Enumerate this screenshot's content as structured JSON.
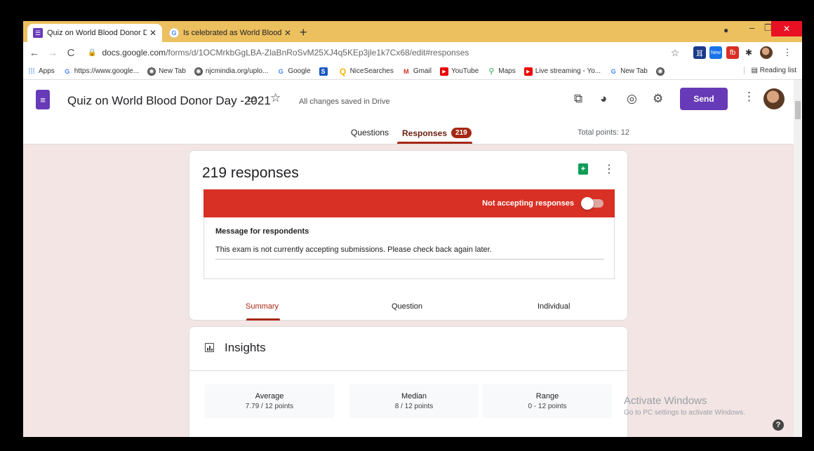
{
  "browser": {
    "tabs": [
      {
        "title": "Quiz on World Blood Donor Day",
        "favicon": "forms-icon"
      },
      {
        "title": "Is celebrated as World Blood Do",
        "favicon": "google-g-icon"
      }
    ],
    "new_tab": "+",
    "url_main": "docs.google.com",
    "url_rest": "/forms/d/1OCMrkbGgLBA-ZlaBnRoSvM25XJ4q5KEp3jle1k7Cx68/edit#responses",
    "bookmarks": [
      {
        "label": "Apps",
        "icon": "apps-grid-icon"
      },
      {
        "label": "https://www.google...",
        "icon": "google-g-icon"
      },
      {
        "label": "New Tab",
        "icon": "globe-icon"
      },
      {
        "label": "njcmindia.org/uplo...",
        "icon": "globe-icon"
      },
      {
        "label": "Google",
        "icon": "google-g-icon"
      },
      {
        "label": "",
        "icon": "s-icon"
      },
      {
        "label": "NiceSearches",
        "icon": "search-icon"
      },
      {
        "label": "Gmail",
        "icon": "gmail-icon"
      },
      {
        "label": "YouTube",
        "icon": "youtube-icon"
      },
      {
        "label": "Maps",
        "icon": "maps-icon"
      },
      {
        "label": "Live streaming - Yo...",
        "icon": "youtube-icon"
      },
      {
        "label": "New Tab",
        "icon": "google-g-icon"
      },
      {
        "label": "",
        "icon": "globe-icon"
      }
    ],
    "reading_list": "Reading list",
    "ext_new_badge": "New"
  },
  "forms_header": {
    "title": "Quiz on World Blood Donor Day -2021",
    "saved_status": "All changes saved in Drive",
    "send_label": "Send",
    "tabs": {
      "questions": "Questions",
      "responses": "Responses",
      "responses_count": "219"
    },
    "total_points": "Total points: 12"
  },
  "responses_card": {
    "heading": "219 responses",
    "banner_label": "Not accepting responses",
    "accepting": false,
    "message_title": "Message for respondents",
    "message_body": "This exam is not currently accepting submissions. Please check back again later.",
    "subtabs": [
      "Summary",
      "Question",
      "Individual"
    ],
    "active_subtab": "Summary"
  },
  "insights": {
    "title": "Insights",
    "stats": [
      {
        "label": "Average",
        "value": "7.79 / 12 points"
      },
      {
        "label": "Median",
        "value": "8 / 12 points"
      },
      {
        "label": "Range",
        "value": "0 - 12 points"
      }
    ]
  },
  "watermark": {
    "title": "Activate Windows",
    "subtitle": "Go to PC settings to activate Windows."
  },
  "colors": {
    "tabstrip": "#ecbf5f",
    "forms_purple": "#673ab7",
    "accent_red": "#a52714",
    "banner_red": "#d93025",
    "background": "#f2e5e4"
  }
}
